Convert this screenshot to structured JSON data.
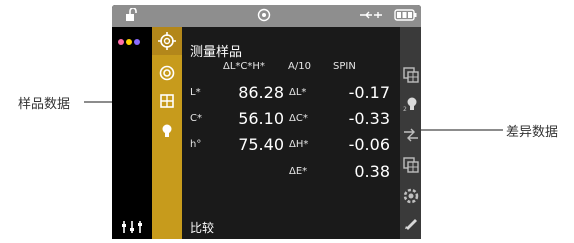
{
  "annotations": {
    "left": "样品数据",
    "right": "差异数据"
  },
  "screen": {
    "title": "测量样品",
    "header": {
      "dlch": "ΔL*C*H*",
      "illuminant": "A/10",
      "mode": "SPIN"
    },
    "sample": [
      {
        "label": "L*",
        "value": "86.28"
      },
      {
        "label": "C*",
        "value": "56.10"
      },
      {
        "label": "h°",
        "value": "75.40"
      }
    ],
    "difference": [
      {
        "label": "ΔL*",
        "value": "-0.17"
      },
      {
        "label": "ΔC*",
        "value": "-0.33"
      },
      {
        "label": "ΔH*",
        "value": "-0.06"
      },
      {
        "label": "ΔE*",
        "value": "0.38"
      }
    ],
    "footer": "比较"
  },
  "status_icons": [
    "lock-icon",
    "target-icon",
    "usb-icon",
    "battery-icon"
  ],
  "left_rail_icons": [
    "more-dots-icon",
    "settings-sliders-icon"
  ],
  "gold_rail_icons": [
    "crosshair-icon",
    "target-icon",
    "grid-icon",
    "bulb-icon"
  ],
  "right_rail_icons": [
    "copy-grid-icon",
    "bulb-icon",
    "arrows-icon",
    "grid-icon",
    "gear-icon",
    "pencil-icon"
  ],
  "colors": {
    "accent_gold": "#c79b1c",
    "screen_bg": "#1a1a1a",
    "status_bar": "#8e8e8e",
    "dot_pink": "#ff6ea8",
    "dot_yellow": "#ffd400",
    "dot_purple": "#8a6cff"
  }
}
